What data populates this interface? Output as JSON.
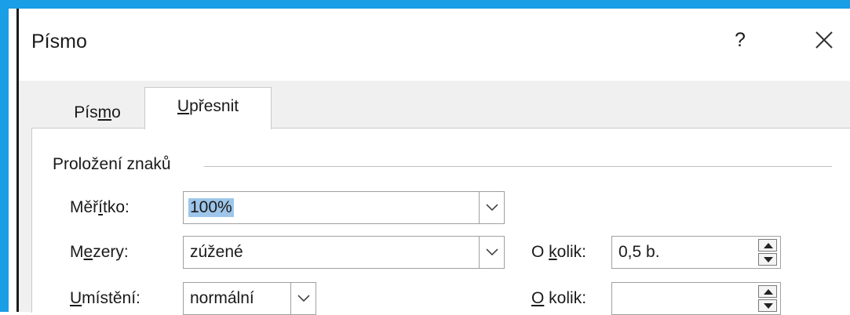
{
  "dialog": {
    "title": "Písmo",
    "help_label": "?",
    "tabs": [
      {
        "pre": "Pís",
        "key": "m",
        "post": "o"
      },
      {
        "pre": "",
        "key": "U",
        "post": "přesnit"
      }
    ]
  },
  "spacing": {
    "group_label": "Proložení znaků",
    "scale": {
      "pre": "Měř",
      "key": "í",
      "post": "tko:",
      "value": "100%"
    },
    "spacing": {
      "pre": "M",
      "key": "e",
      "post": "zery:",
      "value": "zúžené"
    },
    "position": {
      "pre": "",
      "key": "U",
      "post": "místění:",
      "value": "normální"
    },
    "by1": {
      "pre": "O ",
      "key": "k",
      "post": "olik:",
      "value": "0,5 b."
    },
    "by2": {
      "pre": "",
      "key": "O",
      "post": " kolik:",
      "value": ""
    }
  },
  "colors": {
    "accent": "#1a9ee6",
    "selection": "#9ec6ea"
  }
}
